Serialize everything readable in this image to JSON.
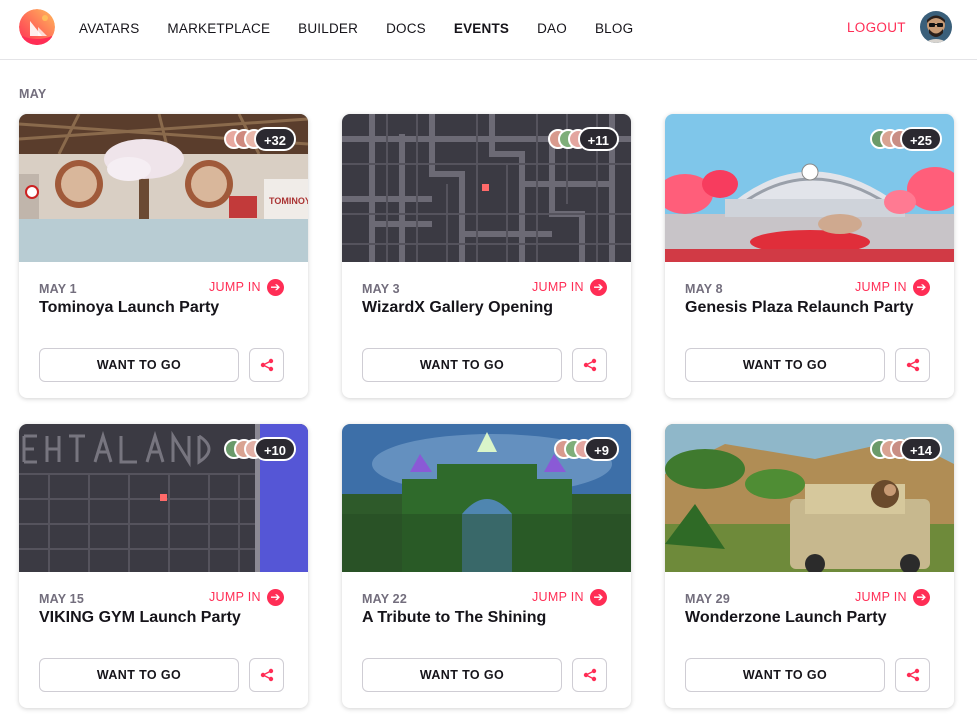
{
  "nav": {
    "items": [
      "AVATARS",
      "MARKETPLACE",
      "BUILDER",
      "DOCS",
      "EVENTS",
      "DAO",
      "BLOG"
    ],
    "active": "EVENTS",
    "logout_label": "LOGOUT"
  },
  "month_label": "MAY",
  "colors": {
    "accent": "#ff2d55",
    "text": "#16141a",
    "muted": "#736e7d"
  },
  "events": [
    {
      "date": "MAY 1",
      "title": "Tominoya Launch Party",
      "attendee_count": "+32",
      "jump_label": "JUMP IN",
      "want_label": "WANT TO GO",
      "scene": "tominoya"
    },
    {
      "date": "MAY 3",
      "title": "WizardX Gallery Opening",
      "attendee_count": "+11",
      "jump_label": "JUMP IN",
      "want_label": "WANT TO GO",
      "scene": "map"
    },
    {
      "date": "MAY 8",
      "title": "Genesis Plaza Relaunch Party",
      "attendee_count": "+25",
      "jump_label": "JUMP IN",
      "want_label": "WANT TO GO",
      "scene": "plaza"
    },
    {
      "date": "MAY 15",
      "title": "VIKING GYM Launch Party",
      "attendee_count": "+10",
      "jump_label": "JUMP IN",
      "want_label": "WANT TO GO",
      "scene": "map-text"
    },
    {
      "date": "MAY 22",
      "title": "A Tribute to The Shining",
      "attendee_count": "+9",
      "jump_label": "JUMP IN",
      "want_label": "WANT TO GO",
      "scene": "hedge"
    },
    {
      "date": "MAY 29",
      "title": "Wonderzone Launch Party",
      "attendee_count": "+14",
      "jump_label": "JUMP IN",
      "want_label": "WANT TO GO",
      "scene": "jungle"
    }
  ]
}
